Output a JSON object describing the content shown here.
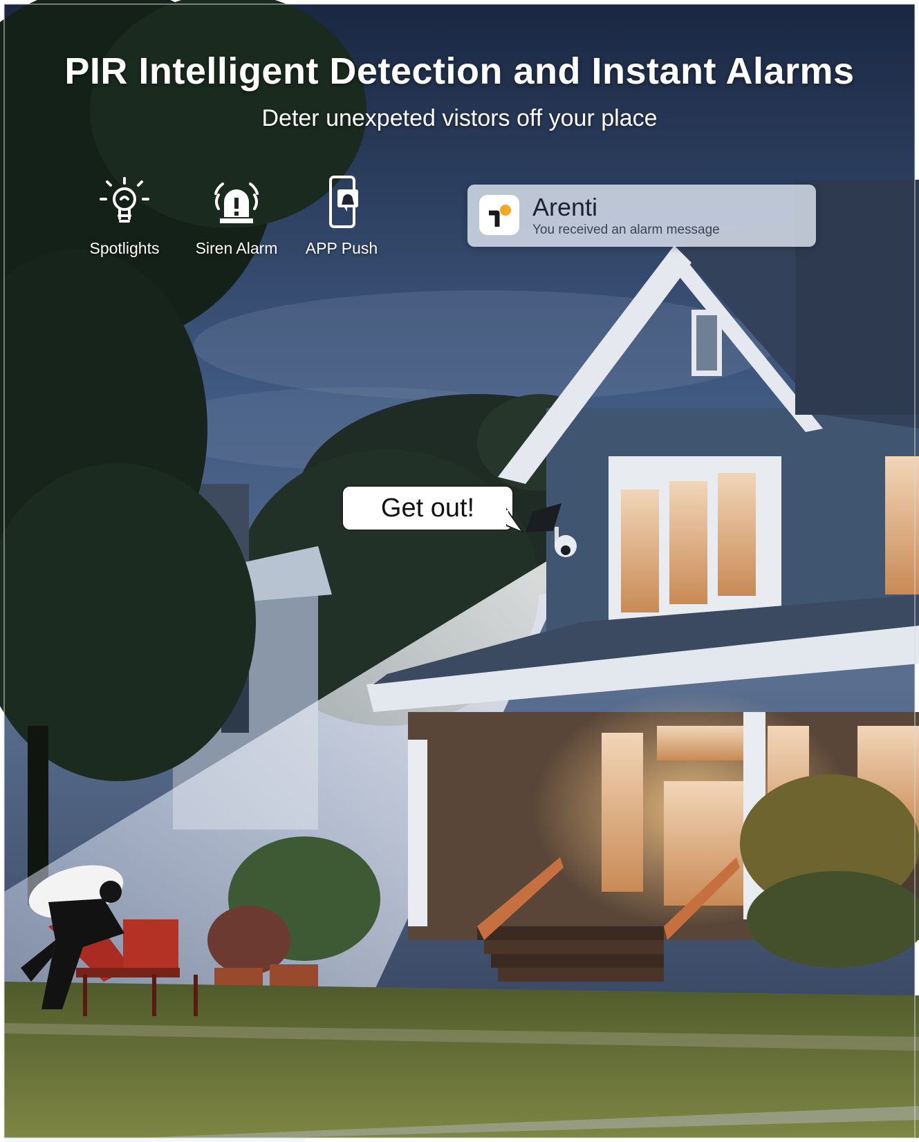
{
  "title": "PIR Intelligent Detection and Instant Alarms",
  "subtitle": "Deter unexpeted vistors off your place",
  "features": [
    {
      "label": "Spotlights",
      "icon": "lightbulb-icon"
    },
    {
      "label": "Siren Alarm",
      "icon": "siren-icon"
    },
    {
      "label": "APP Push",
      "icon": "phone-alert-icon"
    }
  ],
  "notification": {
    "app_name": "Arenti",
    "message": "You received an alarm message",
    "icon": "arenti-app-icon",
    "accent": "#f5a623"
  },
  "speech_bubble": {
    "text": "Get out!"
  },
  "colors": {
    "sky_top": "#1d2c45",
    "sky_mid": "#4a6289",
    "house_siding": "#3f5570",
    "roof": "#33425a",
    "warm_window": "#e6a45e",
    "lawn": "#6f7b3a",
    "spotlight": "#eef4ff"
  }
}
